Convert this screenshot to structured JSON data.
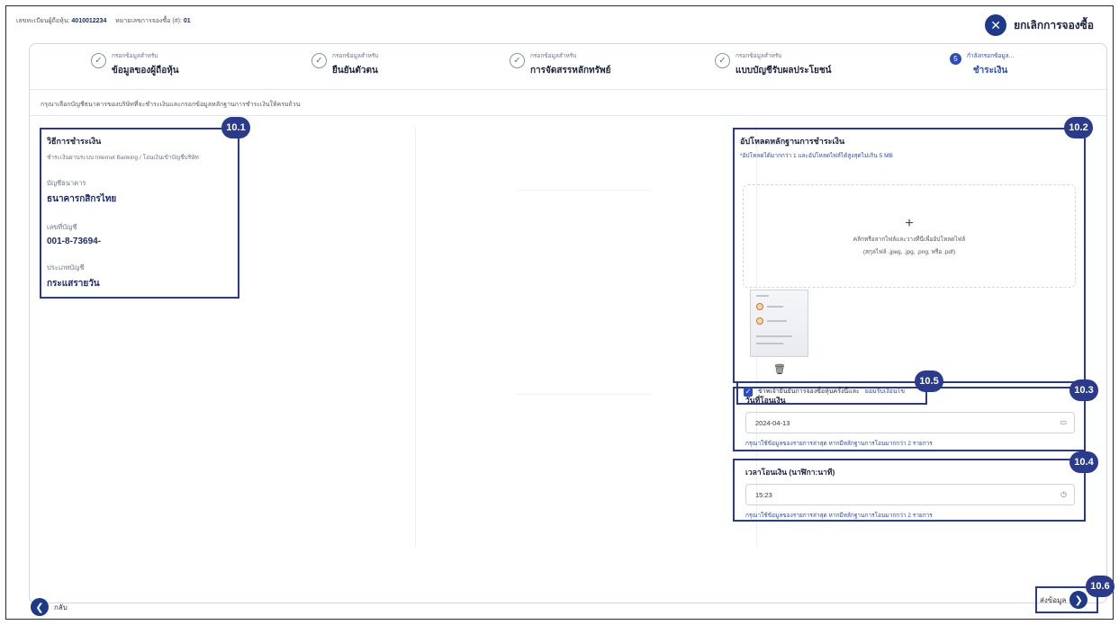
{
  "header": {
    "holder_id_label": "เลขทะเบียนผู้ถือหุ้น:",
    "holder_id_value": "4010012234",
    "booking_no_label": "หมายเลขการจองซื้อ (#):",
    "booking_no_value": "01",
    "cancel_label": "ยกเลิกการจองซื้อ"
  },
  "steps": [
    {
      "small": "กรอกข้อมูลสำหรับ",
      "big": "ข้อมูลของผู้ถือหุ้น",
      "state": "done"
    },
    {
      "small": "กรอกข้อมูลสำหรับ",
      "big": "ยืนยันตัวตน",
      "state": "done"
    },
    {
      "small": "กรอกข้อมูลสำหรับ",
      "big": "การจัดสรรหลักทรัพย์",
      "state": "done"
    },
    {
      "small": "กรอกข้อมูลสำหรับ",
      "big": "แบบบัญชีรับผลประโยชน์",
      "state": "done"
    },
    {
      "number": "5",
      "small": "กำลังกรอกข้อมูล...",
      "big": "ชำระเงิน",
      "state": "active"
    }
  ],
  "instruction": "กรุณาเลือกบัญชีธนาคารของบริษัทที่จะชำระเงินและกรอกข้อมูลหลักฐานการชำระเงินให้ครบถ้วน",
  "badges": {
    "b1": "10.1",
    "b2": "10.2",
    "b3": "10.3",
    "b4": "10.4",
    "b5": "10.5",
    "b6": "10.6"
  },
  "payment": {
    "title": "วิธีการชำระเงิน",
    "method": "ชำระเงินผ่านระบบ Internet Banking / โอนเงินเข้าบัญชีบริษัท",
    "bank_label": "บัญชีธนาคาร",
    "bank_value": "ธนาคารกสิกรไทย",
    "account_label": "เลขที่บัญชี",
    "account_value": "001-8-73694-",
    "type_label": "ประเภทบัญชี",
    "type_value": "กระแสรายวัน"
  },
  "upload": {
    "title": "อัปโหลดหลักฐานการชำระเงิน",
    "hint": "*อัปโหลดได้มากกว่า 1 และอัปโหลดไฟล์ได้สูงสุดไม่เกิน 5 MB",
    "plus": "+",
    "drop_line1": "คลิกหรือลากไฟล์และวางที่นี่เพื่ออัปโหลดไฟล์",
    "drop_line2": "(สกุลไฟล์ .jpeg, .jpg, .png, หรือ .pdf)"
  },
  "transfer_date": {
    "label": "วันที่โอนเงิน",
    "value": "2024-04-13",
    "help": "กรุณาใช้ข้อมูลของรายการล่าสุด หากมีหลักฐานการโอนมากกว่า 2 รายการ"
  },
  "transfer_time": {
    "label": "เวลาโอนเงิน (นาฬิกา:นาที)",
    "value": "15:23",
    "help": "กรุณาใช้ข้อมูลของรายการล่าสุด หากมีหลักฐานการโอนมากกว่า 2 รายการ"
  },
  "consent": {
    "text": "ข้าพเจ้ายืนยันการจองซื้อหุ้นครั้งนี้และ",
    "link": "ยอมรับเงื่อนไข"
  },
  "footer": {
    "back_label": "กลับ",
    "submit_label": "ส่งข้อมูล"
  }
}
